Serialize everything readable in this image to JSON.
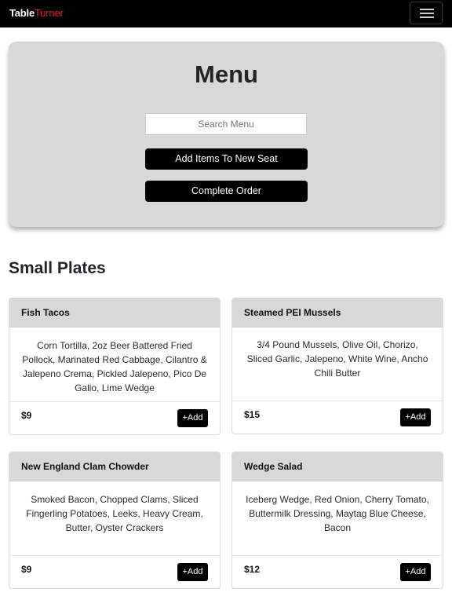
{
  "nav": {
    "brand_part1": "Table",
    "brand_part2": "Turner",
    "menu_toggle_icon": "hamburger-icon"
  },
  "hero": {
    "title": "Menu",
    "search_placeholder": "Search Menu",
    "add_seat_label": "Add Items To New Seat",
    "complete_label": "Complete Order"
  },
  "section": {
    "title": "Small Plates"
  },
  "items": [
    {
      "name": "Fish Tacos",
      "description": "Corn Tortilla, 2oz Beer Battered Fried Pollock, Marinated Red Cabbage, Cilantro & Jalepeno Crema, Pickled Jalepeno, Pico De Gallo, Lime Wedge",
      "price": "$9",
      "add_label": "+Add"
    },
    {
      "name": "Steamed PEI Mussels",
      "description": "3/4 Pound Mussels, Olive Oil, Chorizo, Sliced Garlic, Jalepeno, White Wine, Ancho Chili Butter",
      "price": "$15",
      "add_label": "+Add"
    },
    {
      "name": "New England Clam Chowder",
      "description": "Smoked Bacon, Chopped Clams, Sliced Fingerling Potatoes, Leeks, Heavy Cream, Butter, Oyster Crackers",
      "price": "$9",
      "add_label": "+Add"
    },
    {
      "name": "Wedge Salad",
      "description": "Iceberg Wedge, Red Onion, Cherry Tomato, Buttermilk Dressing, Maytag Blue Cheese, Bacon",
      "price": "$12",
      "add_label": "+Add"
    }
  ],
  "colors": {
    "navbar": "#000000",
    "brand_accent": "#e0202f",
    "hero_background": "#d8d8d8",
    "button": "#000000"
  }
}
